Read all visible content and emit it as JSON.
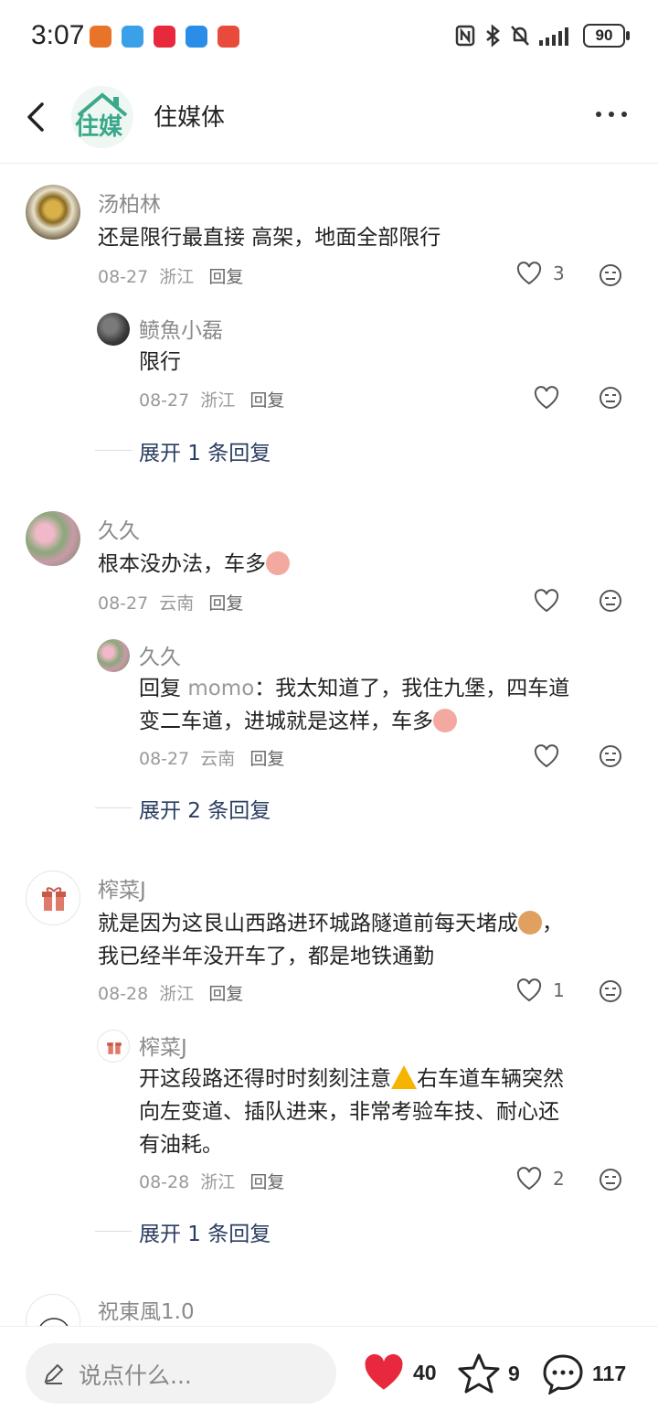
{
  "status_bar": {
    "time": "3:07",
    "battery": "90"
  },
  "header": {
    "title": "住媒体",
    "logo_text": "住媒"
  },
  "comments": [
    {
      "user": "汤柏林",
      "text": "还是限行最直接 高架，地面全部限行",
      "date": "08-27",
      "location": "浙江",
      "reply_label": "回复",
      "likes": "3",
      "sub": {
        "user": "鲼魚小磊",
        "text": "限行",
        "date": "08-27",
        "location": "浙江",
        "reply_label": "回复",
        "likes": ""
      },
      "expand": "展开 1 条回复"
    },
    {
      "user": "久久",
      "text": "根本没办法，车多",
      "date": "08-27",
      "location": "云南",
      "reply_label": "回复",
      "likes": "",
      "sub": {
        "user": "久久",
        "reply_prefix": "回复",
        "reply_to": "momo",
        "text_line1": "：我太知道了，我住九堡，四车道",
        "text_line2": "变二车道，进城就是这样，车多",
        "date": "08-27",
        "location": "云南",
        "reply_label": "回复",
        "likes": ""
      },
      "expand": "展开 2 条回复"
    },
    {
      "user": "榨菜J",
      "text_line1": "就是因为这艮山西路进环城路隧道前每天堵成",
      "text_line1_end": "，",
      "text_line2": "我已经半年没开车了，都是地铁通勤",
      "date": "08-28",
      "location": "浙江",
      "reply_label": "回复",
      "likes": "1",
      "sub": {
        "user": "榨菜J",
        "text_line1a": "开这段路还得时时刻刻注意",
        "text_line1b": "右车道车辆突然",
        "text_line2": "向左变道、插队进来，非常考验车技、耐心还",
        "text_line3": "有油耗。",
        "date": "08-28",
        "location": "浙江",
        "reply_label": "回复",
        "likes": "2"
      },
      "expand": "展开 1 条回复"
    },
    {
      "user": "祝東風1.0"
    }
  ],
  "bottom_bar": {
    "input_placeholder": "说点什么...",
    "likes": "40",
    "favorites": "9",
    "comments": "117"
  },
  "colors": {
    "accent": "#e8283c",
    "link": "#2a3d60",
    "muted": "#999999"
  }
}
